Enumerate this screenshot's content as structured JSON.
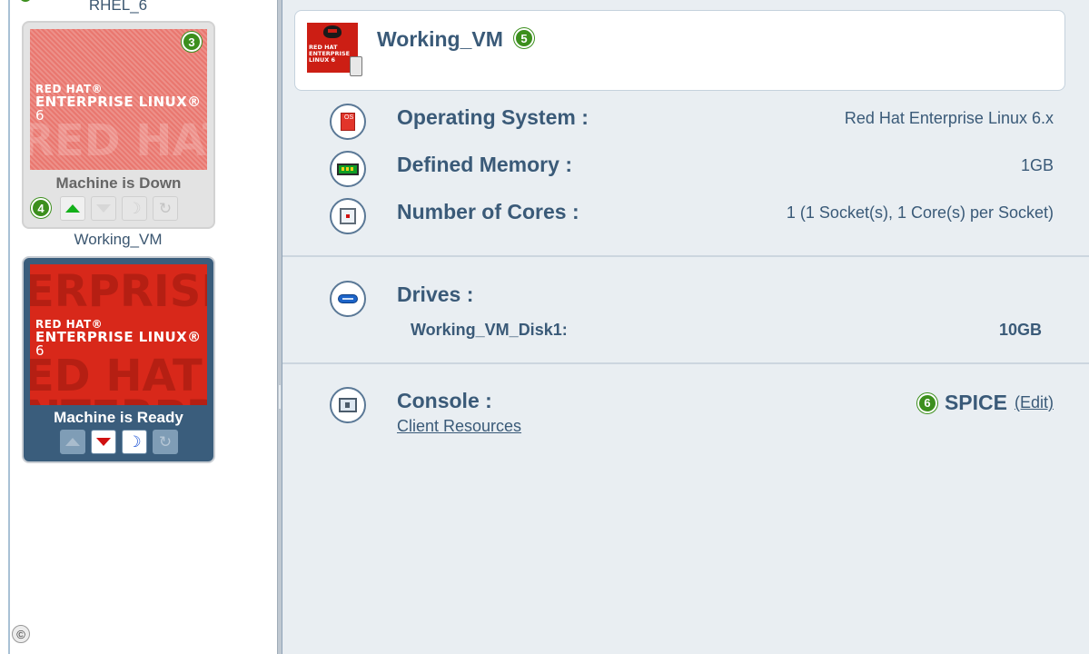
{
  "vm_list": [
    {
      "name": "RHEL_6",
      "status": "Machine is Down",
      "logo": {
        "brand": "RED HAT®",
        "product": "ENTERPRISE LINUX®",
        "version": "6"
      },
      "running_count_badge": "3",
      "actions_badge": "4",
      "state": "down"
    },
    {
      "name": "Working_VM",
      "status": "Machine is Ready",
      "logo": {
        "brand": "RED HAT®",
        "product": "ENTERPRISE LINUX®",
        "version": "6"
      },
      "state": "up"
    }
  ],
  "copyright_icon": "©",
  "details": {
    "vm_name": "Working_VM",
    "name_badge": "5",
    "properties": {
      "os_label": "Operating System :",
      "os_value": "Red Hat Enterprise Linux 6.x",
      "memory_label": "Defined Memory :",
      "memory_value": "1GB",
      "cores_label": "Number of Cores :",
      "cores_value": "1 (1 Socket(s), 1 Core(s) per Socket)"
    },
    "drives": {
      "label": "Drives :",
      "items": [
        {
          "name": "Working_VM_Disk1:",
          "size": "10GB"
        }
      ]
    },
    "console": {
      "label": "Console :",
      "badge": "6",
      "protocol": "SPICE",
      "edit_label": "(Edit)",
      "client_resources_label": "Client Resources"
    }
  },
  "colors": {
    "accent_text": "#3a5a78",
    "badge_green": "#3c8f1d",
    "panel_bg": "#e9eef2",
    "selected_card_bg": "#3a5d7c",
    "redhat_red": "#cc1e14"
  }
}
